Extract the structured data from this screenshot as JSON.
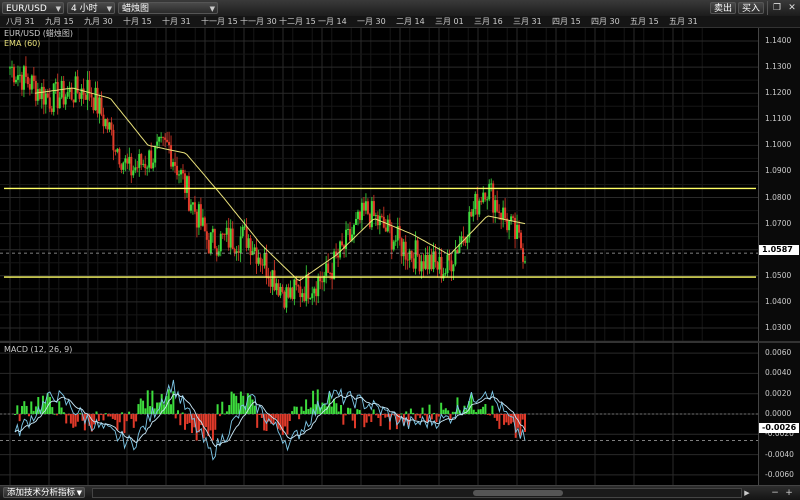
{
  "toolbar": {
    "symbol": "EUR/USD",
    "timeframe": "4 小时",
    "chart_style": "蜡烛图",
    "sell_label": "卖出",
    "buy_label": "买入"
  },
  "date_axis": [
    "八月 31",
    "九月 15",
    "九月 30",
    "十月 15",
    "十月 31",
    "十一月 15",
    "十一月 30",
    "十二月 15",
    "一月 14",
    "一月 30",
    "二月 14",
    "三月 01",
    "三月 16",
    "三月 31",
    "四月 15",
    "四月 30",
    "五月 15",
    "五月 31"
  ],
  "price_panel": {
    "label_symbol": "EUR/USD (蜡烛图)",
    "label_ema": "EMA (60)",
    "current_price": "1.0587",
    "ticks": [
      "1.1400",
      "1.1300",
      "1.1200",
      "1.1100",
      "1.1000",
      "1.0900",
      "1.0800",
      "1.0700",
      "1.0600",
      "1.0500",
      "1.0400",
      "1.0300"
    ]
  },
  "macd_panel": {
    "label": "MACD (12, 26, 9)",
    "current_value": "-0.0026",
    "ticks": [
      "0.0060",
      "0.0040",
      "0.0020",
      "0.0000",
      "-0.0020",
      "-0.0040",
      "-0.0060"
    ]
  },
  "bottom": {
    "add_indicator": "添加技术分析指标"
  },
  "colors": {
    "up": "#3ddc3d",
    "down": "#e03a2a",
    "ema": "#e8e07a",
    "level_line": "#ffff66",
    "macd_line": "#7ec8e8",
    "signal_line": "#c8e8f8"
  },
  "chart_data": [
    {
      "type": "line",
      "series": [
        {
          "name": "EUR/USD (蜡烛图)",
          "x": [
            "八月 31",
            "九月 15",
            "九月 30",
            "十月 15",
            "十月 31",
            "十一月 15",
            "十一月 30",
            "十二月 15",
            "一月 14",
            "一月 30",
            "二月 14",
            "三月 01",
            "三月 16",
            "三月 31"
          ],
          "values": [
            1.13,
            1.118,
            1.122,
            1.09,
            1.1,
            1.063,
            1.065,
            1.042,
            1.05,
            1.075,
            1.06,
            1.052,
            1.085,
            1.059
          ]
        },
        {
          "name": "EMA (60)",
          "x": [
            "八月 31",
            "九月 15",
            "九月 30",
            "十月 15",
            "十月 31",
            "十一月 15",
            "十一月 30",
            "十二月 15",
            "一月 14",
            "一月 30",
            "二月 14",
            "三月 01",
            "三月 16",
            "三月 31"
          ],
          "values": [
            1.12,
            1.122,
            1.118,
            1.1,
            1.097,
            1.08,
            1.062,
            1.048,
            1.058,
            1.072,
            1.066,
            1.058,
            1.073,
            1.07
          ]
        }
      ],
      "horizontal_lines": [
        1.0835,
        1.0495
      ],
      "ylim": [
        1.025,
        1.145
      ],
      "grid": true
    },
    {
      "type": "line",
      "series": [
        {
          "name": "MACD (12, 26, 9)",
          "x": [
            "八月 31",
            "九月 15",
            "九月 30",
            "十月 15",
            "十月 31",
            "十一月 15",
            "十一月 30",
            "十二月 15",
            "一月 14",
            "一月 30",
            "二月 14",
            "三月 01",
            "三月 16",
            "三月 31"
          ],
          "values": [
            -0.002,
            0.002,
            -0.001,
            -0.003,
            0.003,
            -0.004,
            0.0015,
            -0.003,
            0.002,
            0.001,
            -0.001,
            -0.0005,
            0.0025,
            -0.0026
          ]
        }
      ],
      "ylim": [
        -0.007,
        0.007
      ],
      "grid": true
    }
  ]
}
